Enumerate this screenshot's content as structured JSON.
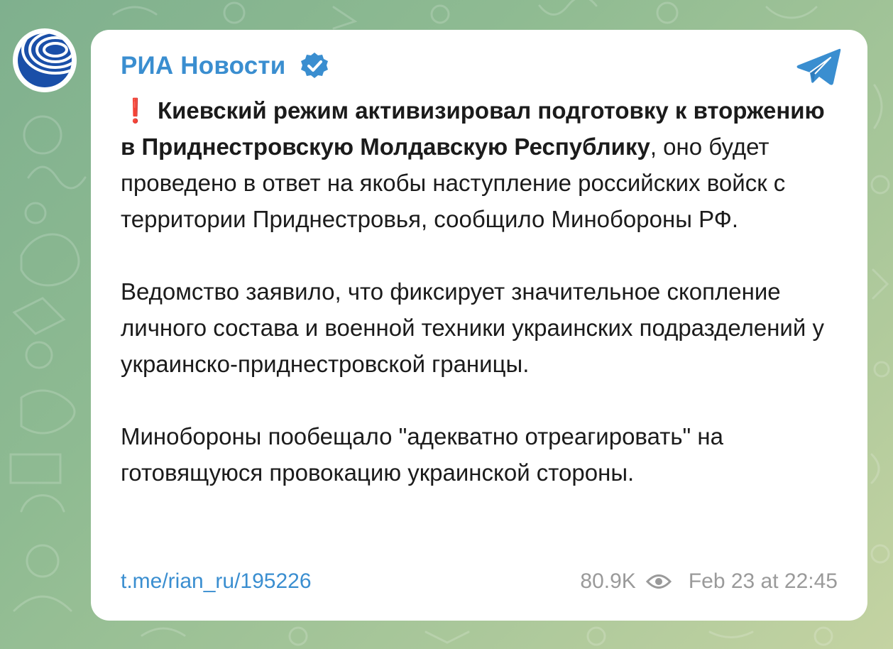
{
  "post": {
    "channel_name": "РИА Новости",
    "verified": true,
    "lead_emoji": "❗",
    "lead_bold": "Киевский режим активизировал подготовку к вторжению в Приднестровскую Молдавскую Республику",
    "lead_rest": ", оно будет проведено в ответ на якобы наступление российских войск с территории Приднестровья, сообщило Минобороны РФ.",
    "paragraph_2": "Ведомство заявило, что фиксирует значительное скопление личного состава и военной техники украинских подразделений у украинско-приднестровской границы.",
    "paragraph_3": "Минобороны пообещало \"адекватно отреагировать\" на готовящуюся провокацию украинской стороны.",
    "link": "t.me/rian_ru/195226",
    "views": "80.9K",
    "timestamp": "Feb 23 at 22:45"
  },
  "icons": {
    "avatar": "ria-logo",
    "verified": "verified-badge-icon",
    "app": "telegram-icon",
    "views": "eye-icon"
  },
  "colors": {
    "accent": "#3a8ed0",
    "verified_badge": "#3a8ed0",
    "exclamation": "#e0302b",
    "meta_text": "#9a9a9a"
  }
}
